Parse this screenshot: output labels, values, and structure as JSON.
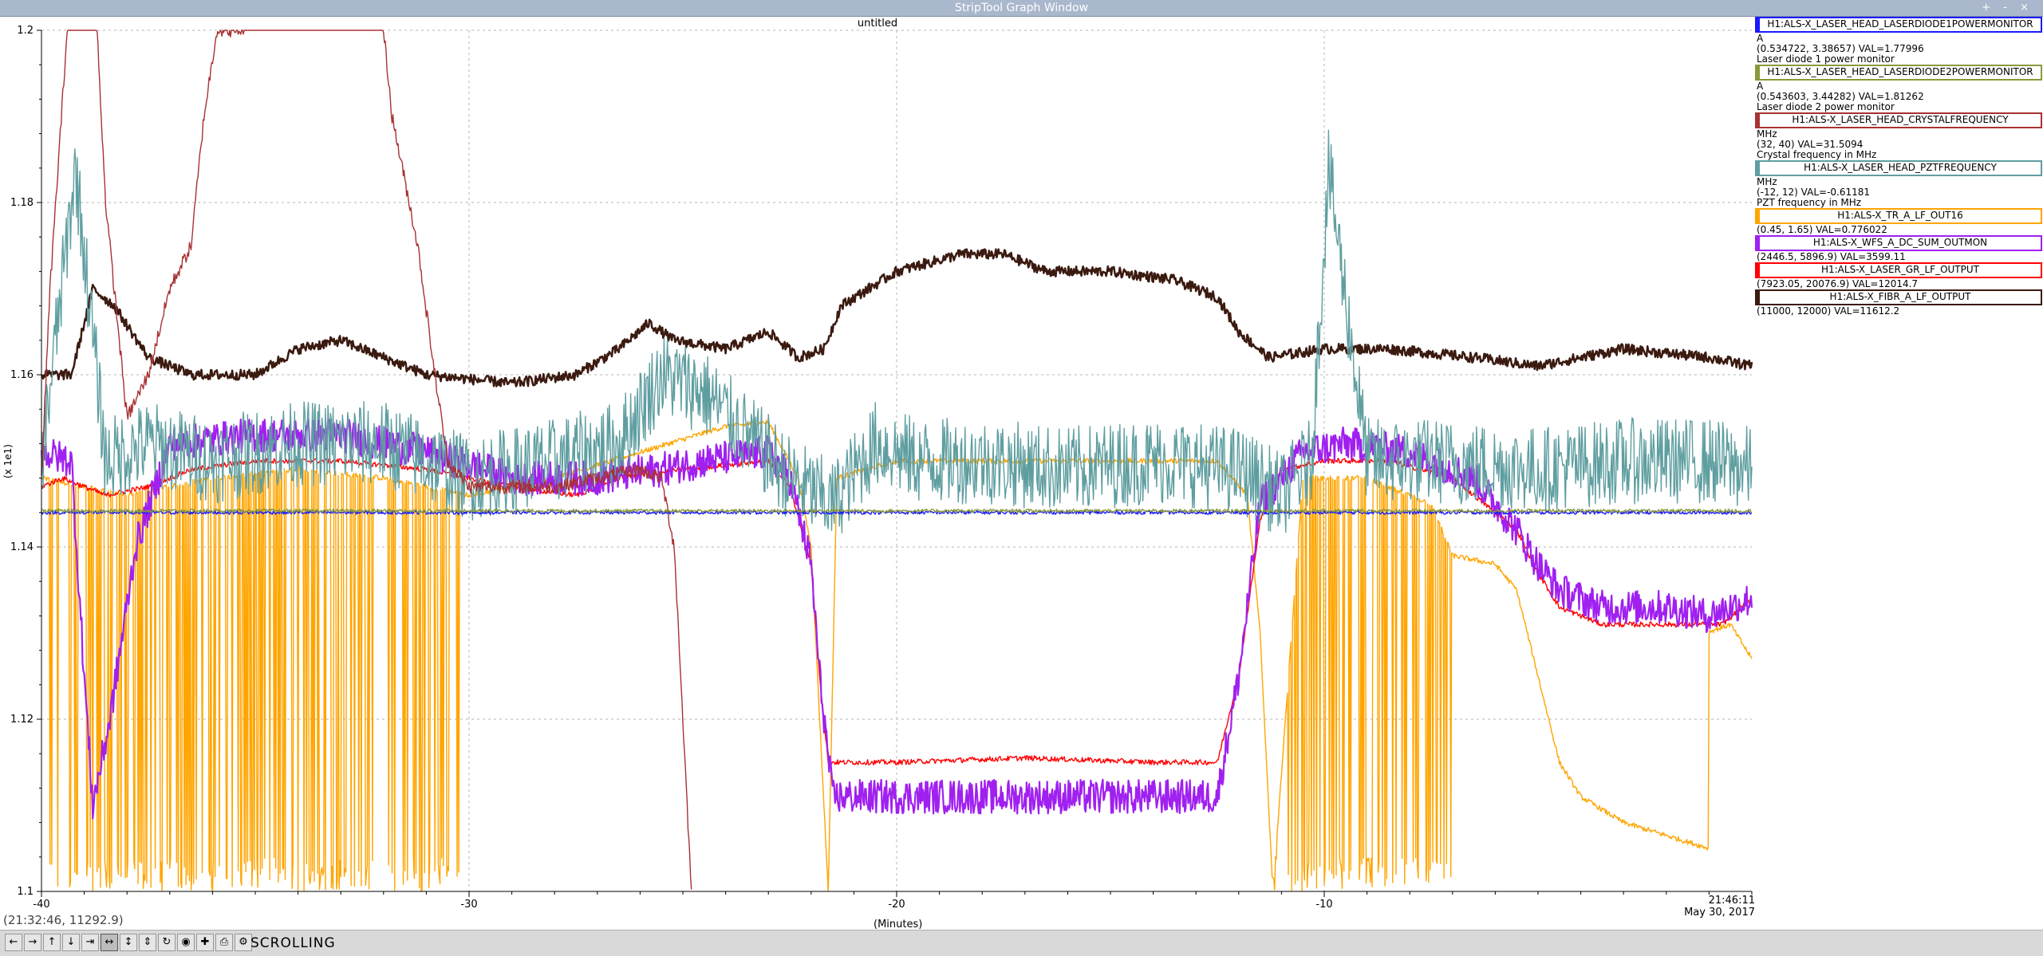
{
  "window": {
    "title": "StripTool Graph Window",
    "controls": "+ - ×"
  },
  "plot_title": "untitled",
  "coordinate_readout": "(21:32:46, 11292.9)",
  "x_axis_label": "(Minutes)",
  "y_axis_label": "(x 1e1)",
  "timestamp": {
    "time": "21:46:11",
    "date": "May 30, 2017"
  },
  "toolbar": {
    "status": "SCROLLING",
    "buttons": [
      {
        "name": "pan-left",
        "glyph": "←"
      },
      {
        "name": "pan-right",
        "glyph": "→"
      },
      {
        "name": "pan-up",
        "glyph": "↑"
      },
      {
        "name": "pan-down",
        "glyph": "↓"
      },
      {
        "name": "zoom-x-in",
        "glyph": "⇥"
      },
      {
        "name": "zoom-x-out",
        "glyph": "↔"
      },
      {
        "name": "zoom-y-in",
        "glyph": "↕"
      },
      {
        "name": "zoom-y-out",
        "glyph": "⇕"
      },
      {
        "name": "refresh",
        "glyph": "↻"
      },
      {
        "name": "auto-scroll",
        "glyph": "◉"
      },
      {
        "name": "add",
        "glyph": "✚"
      },
      {
        "name": "print",
        "glyph": "⎙"
      },
      {
        "name": "controls",
        "glyph": "⚙"
      }
    ]
  },
  "legend": [
    {
      "pv": "H1:ALS-X_LASER_HEAD_LASERDIODE1POWERMONITOR",
      "color": "#1a1aff",
      "lines": [
        "A",
        "(0.534722, 3.38657) VAL=1.77996",
        "Laser diode 1 power monitor"
      ]
    },
    {
      "pv": "H1:ALS-X_LASER_HEAD_LASERDIODE2POWERMONITOR",
      "color": "#8a9a3a",
      "lines": [
        "A",
        "(0.543603, 3.44282) VAL=1.81262",
        "Laser diode 2 power monitor"
      ]
    },
    {
      "pv": "H1:ALS-X_LASER_HEAD_CRYSTALFREQUENCY",
      "color": "#a83232",
      "lines": [
        "MHz",
        "(32, 40) VAL=31.5094",
        "Crystal frequency in MHz"
      ]
    },
    {
      "pv": "H1:ALS-X_LASER_HEAD_PZTFREQUENCY",
      "color": "#5f9ea0",
      "lines": [
        "MHz",
        "(-12, 12) VAL=-0.61181",
        "PZT frequency in MHz"
      ]
    },
    {
      "pv": "H1:ALS-X_TR_A_LF_OUT16",
      "color": "#ffa500",
      "lines": [
        "(0.45, 1.65) VAL=0.776022"
      ]
    },
    {
      "pv": "H1:ALS-X_WFS_A_DC_SUM_OUTMON",
      "color": "#a020f0",
      "lines": [
        "(2446.5, 5896.9) VAL=3599.11"
      ]
    },
    {
      "pv": "H1:ALS-X_LASER_GR_LF_OUTPUT",
      "color": "#ff0000",
      "lines": [
        "(7923.05, 20076.9) VAL=12014.7"
      ]
    },
    {
      "pv": "H1:ALS-X_FIBR_A_LF_OUTPUT",
      "color": "#3b1a10",
      "lines": [
        "(11000, 12000) VAL=11612.2"
      ]
    }
  ],
  "chart_data": {
    "type": "line",
    "title": "untitled",
    "xlabel": "(Minutes)",
    "ylabel": "(x 1e1)",
    "xlim": [
      -40,
      0
    ],
    "ylim": [
      1.1,
      1.2
    ],
    "x_ticks": [
      "-40",
      "-30",
      "-20",
      "-10"
    ],
    "y_ticks": [
      "1.1",
      "1.12",
      "1.14",
      "1.16",
      "1.18",
      "1.2"
    ],
    "grid": true,
    "legend_position": "right",
    "series": [
      {
        "name": "H1:ALS-X_LASER_HEAD_LASERDIODE1POWERMONITOR",
        "color": "#1a1aff",
        "noise": 0.0002,
        "points": [
          [
            -40,
            1.144
          ],
          [
            0,
            1.144
          ]
        ]
      },
      {
        "name": "H1:ALS-X_LASER_HEAD_LASERDIODE2POWERMONITOR",
        "color": "#8a9a3a",
        "noise": 0.0002,
        "points": [
          [
            -40,
            1.1442
          ],
          [
            0,
            1.1442
          ]
        ]
      },
      {
        "name": "H1:ALS-X_LASER_HEAD_CRYSTALFREQUENCY",
        "color": "#a83232",
        "noise": 0.0008,
        "points": [
          [
            -40,
            1.148
          ],
          [
            -39.8,
            1.17
          ],
          [
            -39.4,
            1.2
          ],
          [
            -38.8,
            1.21
          ],
          [
            -38.5,
            1.18
          ],
          [
            -38.0,
            1.155
          ],
          [
            -37.5,
            1.16
          ],
          [
            -37.0,
            1.17
          ],
          [
            -36.5,
            1.175
          ],
          [
            -36.2,
            1.19
          ],
          [
            -35.9,
            1.2
          ],
          [
            -35.6,
            1.2
          ],
          [
            -35.3,
            1.2
          ],
          [
            -34.5,
            1.21
          ],
          [
            -33.0,
            1.205
          ],
          [
            -32.0,
            1.2
          ],
          [
            -31.8,
            1.19
          ],
          [
            -31.2,
            1.175
          ],
          [
            -30.8,
            1.16
          ],
          [
            -30.5,
            1.15
          ],
          [
            -30.0,
            1.147
          ],
          [
            -28.0,
            1.147
          ],
          [
            -27.0,
            1.148
          ],
          [
            -26.0,
            1.149
          ],
          [
            -25.5,
            1.148
          ],
          [
            -25.2,
            1.14
          ],
          [
            -25.0,
            1.12
          ],
          [
            -24.8,
            1.1
          ]
        ]
      },
      {
        "name": "H1:ALS-X_LASER_HEAD_PZTFREQUENCY",
        "color": "#5f9ea0",
        "noise": 0.005,
        "points": [
          [
            -40,
            1.15
          ],
          [
            -39.2,
            1.184
          ],
          [
            -38.5,
            1.15
          ],
          [
            -37.5,
            1.152
          ],
          [
            -36.0,
            1.15
          ],
          [
            -34.0,
            1.152
          ],
          [
            -32.0,
            1.152
          ],
          [
            -30.0,
            1.148
          ],
          [
            -28.0,
            1.15
          ],
          [
            -26.5,
            1.152
          ],
          [
            -25.5,
            1.16
          ],
          [
            -24.5,
            1.158
          ],
          [
            -23.5,
            1.153
          ],
          [
            -22.5,
            1.148
          ],
          [
            -21.5,
            1.145
          ],
          [
            -20.5,
            1.152
          ],
          [
            -19.5,
            1.15
          ],
          [
            -18.0,
            1.15
          ],
          [
            -16.0,
            1.149
          ],
          [
            -14.0,
            1.15
          ],
          [
            -12.0,
            1.149
          ],
          [
            -11.0,
            1.146
          ],
          [
            -10.3,
            1.15
          ],
          [
            -9.9,
            1.184
          ],
          [
            -9.0,
            1.15
          ],
          [
            -7.5,
            1.15
          ],
          [
            -5.0,
            1.149
          ],
          [
            -3.0,
            1.15
          ],
          [
            -1.0,
            1.15
          ],
          [
            0,
            1.149
          ]
        ]
      },
      {
        "name": "H1:ALS-X_TR_A_LF_OUT16",
        "color": "#ffa500",
        "noise": 0.0003,
        "spiky": [
          [
            -39.8,
            -30.2
          ],
          [
            -11.2,
            -7.0
          ]
        ],
        "points": [
          [
            -40,
            1.148
          ],
          [
            -38.0,
            1.146
          ],
          [
            -36.0,
            1.148
          ],
          [
            -34.0,
            1.149
          ],
          [
            -32.0,
            1.148
          ],
          [
            -30.0,
            1.146
          ],
          [
            -28.0,
            1.148
          ],
          [
            -26.0,
            1.151
          ],
          [
            -24.0,
            1.154
          ],
          [
            -23.0,
            1.1545
          ],
          [
            -22.3,
            1.148
          ],
          [
            -22.0,
            1.14
          ],
          [
            -21.8,
            1.12
          ],
          [
            -21.6,
            1.1
          ],
          [
            -21.4,
            1.148
          ],
          [
            -20.0,
            1.15
          ],
          [
            -17.0,
            1.15
          ],
          [
            -14.0,
            1.15
          ],
          [
            -12.5,
            1.15
          ],
          [
            -11.8,
            1.146
          ],
          [
            -11.5,
            1.13
          ],
          [
            -11.2,
            1.1
          ],
          [
            -10.5,
            1.148
          ],
          [
            -9.0,
            1.148
          ],
          [
            -7.5,
            1.145
          ],
          [
            -7.0,
            1.139
          ],
          [
            -6.0,
            1.138
          ],
          [
            -5.5,
            1.135
          ],
          [
            -5.0,
            1.125
          ],
          [
            -4.5,
            1.115
          ],
          [
            -4.0,
            1.111
          ],
          [
            -3.0,
            1.108
          ],
          [
            -1.0,
            1.105
          ],
          [
            -1.1,
            1.13
          ],
          [
            -0.5,
            1.131
          ],
          [
            0,
            1.127
          ]
        ]
      },
      {
        "name": "H1:ALS-X_WFS_A_DC_SUM_OUTMON",
        "color": "#a020f0",
        "noise": 0.002,
        "points": [
          [
            -40,
            1.151
          ],
          [
            -39.3,
            1.15
          ],
          [
            -39.0,
            1.125
          ],
          [
            -38.8,
            1.11
          ],
          [
            -38.4,
            1.12
          ],
          [
            -37.8,
            1.14
          ],
          [
            -37.0,
            1.152
          ],
          [
            -35.0,
            1.153
          ],
          [
            -33.0,
            1.153
          ],
          [
            -31.0,
            1.151
          ],
          [
            -29.0,
            1.148
          ],
          [
            -27.0,
            1.148
          ],
          [
            -25.5,
            1.149
          ],
          [
            -24.5,
            1.15
          ],
          [
            -23.0,
            1.151
          ],
          [
            -22.5,
            1.148
          ],
          [
            -22.0,
            1.138
          ],
          [
            -21.8,
            1.125
          ],
          [
            -21.5,
            1.111
          ],
          [
            -20.0,
            1.111
          ],
          [
            -18.0,
            1.111
          ],
          [
            -16.0,
            1.111
          ],
          [
            -14.0,
            1.111
          ],
          [
            -12.5,
            1.111
          ],
          [
            -12.0,
            1.125
          ],
          [
            -11.5,
            1.145
          ],
          [
            -11.0,
            1.148
          ],
          [
            -10.5,
            1.151
          ],
          [
            -9.5,
            1.152
          ],
          [
            -8.0,
            1.151
          ],
          [
            -6.5,
            1.148
          ],
          [
            -5.5,
            1.142
          ],
          [
            -5.0,
            1.138
          ],
          [
            -4.5,
            1.135
          ],
          [
            -3.5,
            1.133
          ],
          [
            -2.0,
            1.133
          ],
          [
            -1.0,
            1.132
          ],
          [
            0,
            1.134
          ]
        ]
      },
      {
        "name": "H1:ALS-X_LASER_GR_LF_OUTPUT",
        "color": "#ff0000",
        "noise": 0.0003,
        "points": [
          [
            -40,
            1.147
          ],
          [
            -39.5,
            1.148
          ],
          [
            -38.5,
            1.146
          ],
          [
            -37.5,
            1.147
          ],
          [
            -36.5,
            1.149
          ],
          [
            -35.0,
            1.15
          ],
          [
            -33.0,
            1.15
          ],
          [
            -31.0,
            1.149
          ],
          [
            -29.0,
            1.147
          ],
          [
            -27.5,
            1.146
          ],
          [
            -26.5,
            1.148
          ],
          [
            -25.0,
            1.149
          ],
          [
            -23.0,
            1.15
          ],
          [
            -22.5,
            1.147
          ],
          [
            -22.0,
            1.138
          ],
          [
            -21.8,
            1.125
          ],
          [
            -21.6,
            1.115
          ],
          [
            -20.0,
            1.115
          ],
          [
            -17.0,
            1.1155
          ],
          [
            -14.0,
            1.115
          ],
          [
            -12.5,
            1.115
          ],
          [
            -12.0,
            1.125
          ],
          [
            -11.5,
            1.143
          ],
          [
            -11.0,
            1.149
          ],
          [
            -10.0,
            1.15
          ],
          [
            -8.5,
            1.15
          ],
          [
            -7.0,
            1.148
          ],
          [
            -5.5,
            1.142
          ],
          [
            -5.0,
            1.137
          ],
          [
            -4.5,
            1.133
          ],
          [
            -3.5,
            1.131
          ],
          [
            -1.5,
            1.131
          ],
          [
            -0.7,
            1.131
          ],
          [
            0,
            1.134
          ]
        ]
      },
      {
        "name": "H1:ALS-X_FIBR_A_LF_OUTPUT",
        "color": "#3b1a10",
        "noise": 0.0006,
        "points": [
          [
            -40,
            1.16
          ],
          [
            -39.3,
            1.16
          ],
          [
            -38.8,
            1.17
          ],
          [
            -38.3,
            1.168
          ],
          [
            -37.5,
            1.162
          ],
          [
            -36.5,
            1.16
          ],
          [
            -35.0,
            1.16
          ],
          [
            -34.0,
            1.163
          ],
          [
            -33.0,
            1.164
          ],
          [
            -32.0,
            1.162
          ],
          [
            -31.0,
            1.16
          ],
          [
            -29.0,
            1.159
          ],
          [
            -27.5,
            1.16
          ],
          [
            -26.5,
            1.163
          ],
          [
            -25.8,
            1.166
          ],
          [
            -25.2,
            1.164
          ],
          [
            -24.0,
            1.163
          ],
          [
            -23.0,
            1.165
          ],
          [
            -22.3,
            1.162
          ],
          [
            -21.7,
            1.163
          ],
          [
            -21.3,
            1.168
          ],
          [
            -20.0,
            1.172
          ],
          [
            -18.5,
            1.174
          ],
          [
            -17.5,
            1.174
          ],
          [
            -16.5,
            1.172
          ],
          [
            -15.0,
            1.172
          ],
          [
            -13.5,
            1.171
          ],
          [
            -12.5,
            1.169
          ],
          [
            -12.0,
            1.165
          ],
          [
            -11.3,
            1.162
          ],
          [
            -10.0,
            1.163
          ],
          [
            -8.5,
            1.163
          ],
          [
            -6.5,
            1.162
          ],
          [
            -5.0,
            1.161
          ],
          [
            -3.0,
            1.163
          ],
          [
            -1.0,
            1.162
          ],
          [
            0,
            1.161
          ]
        ]
      }
    ]
  }
}
